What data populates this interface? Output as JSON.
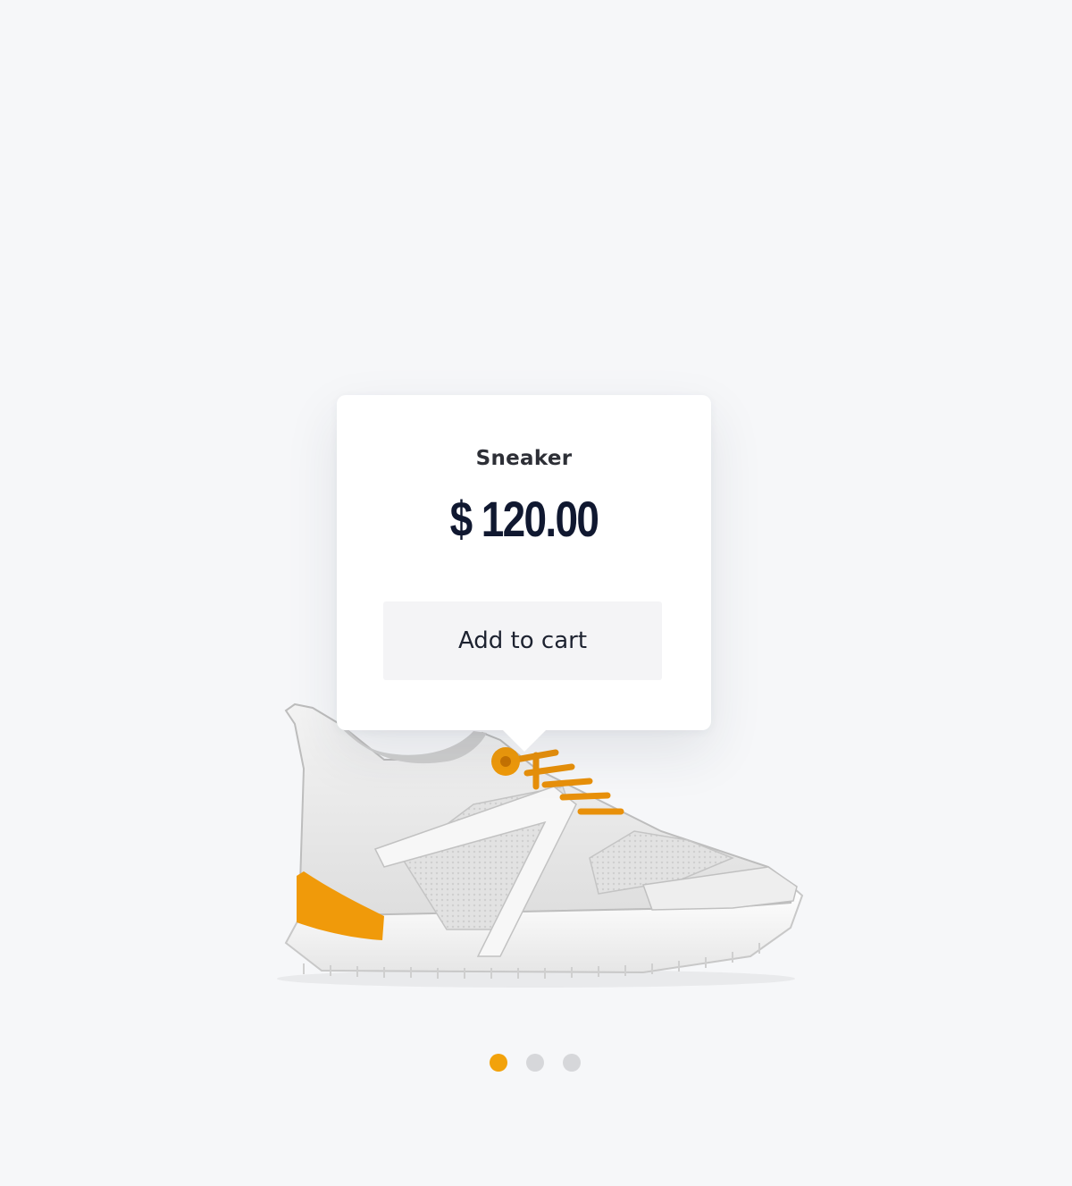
{
  "product": {
    "name": "Sneaker",
    "price": "$ 120.00",
    "image": "white-sneaker-orange-accents",
    "accent_color": "#f2a20b"
  },
  "popover": {
    "cta_label": "Add to cart"
  },
  "carousel": {
    "count": 3,
    "active_index": 0,
    "active_color": "#f2a20b",
    "inactive_color": "#d6d7da"
  }
}
